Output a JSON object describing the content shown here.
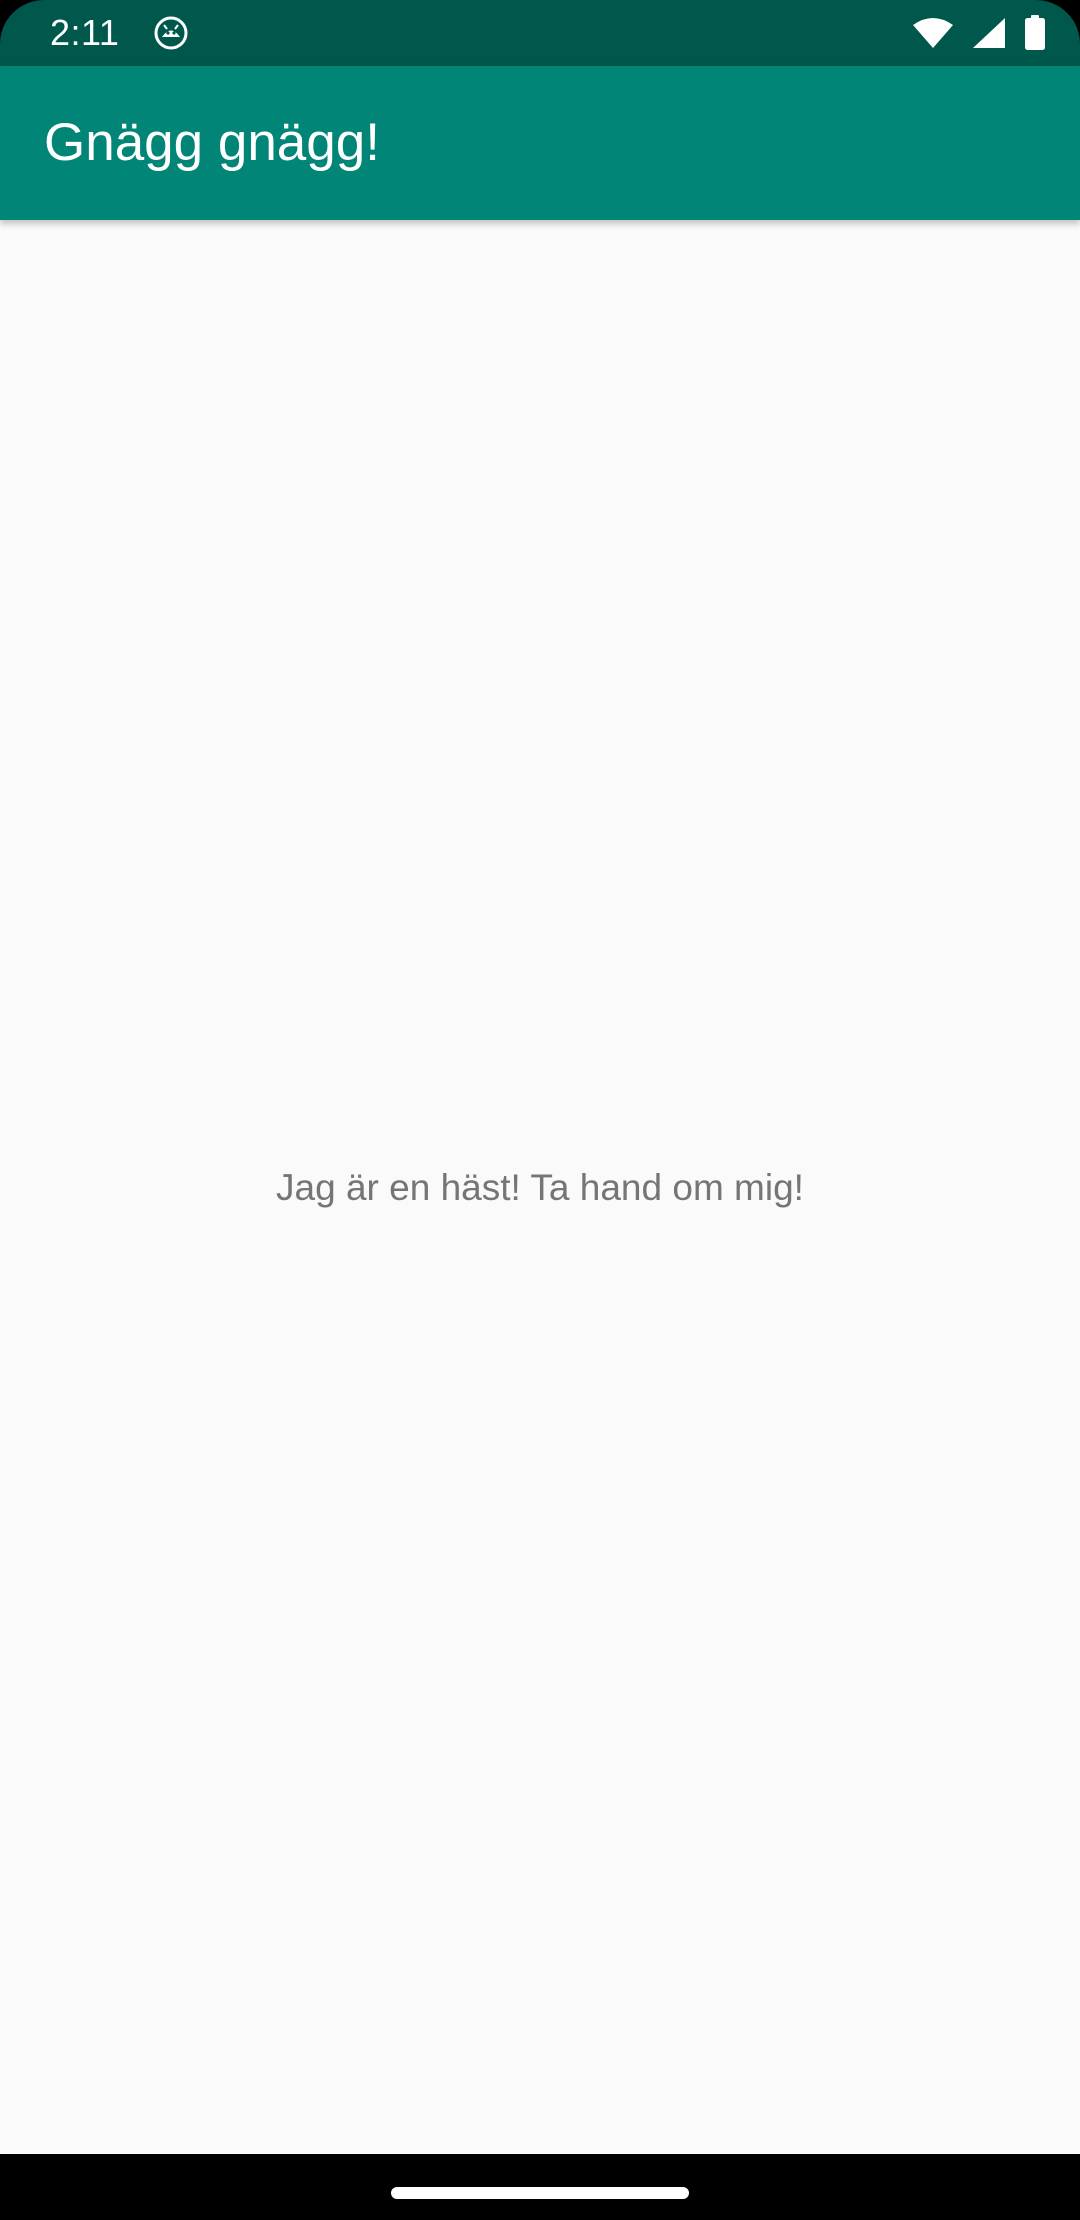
{
  "status_bar": {
    "time": "2:11",
    "app_icon": "android-head-icon",
    "icons": [
      "wifi-icon",
      "cell-signal-icon",
      "battery-icon"
    ],
    "background_color": "#00574B"
  },
  "app_bar": {
    "title": "Gnägg gnägg!",
    "background_color": "#008577"
  },
  "main": {
    "message": "Jag är en häst! Ta hand om mig!",
    "background_color": "#FAFAFA",
    "text_color": "#757575"
  },
  "nav_bar": {
    "handle": "home-gesture-handle"
  }
}
